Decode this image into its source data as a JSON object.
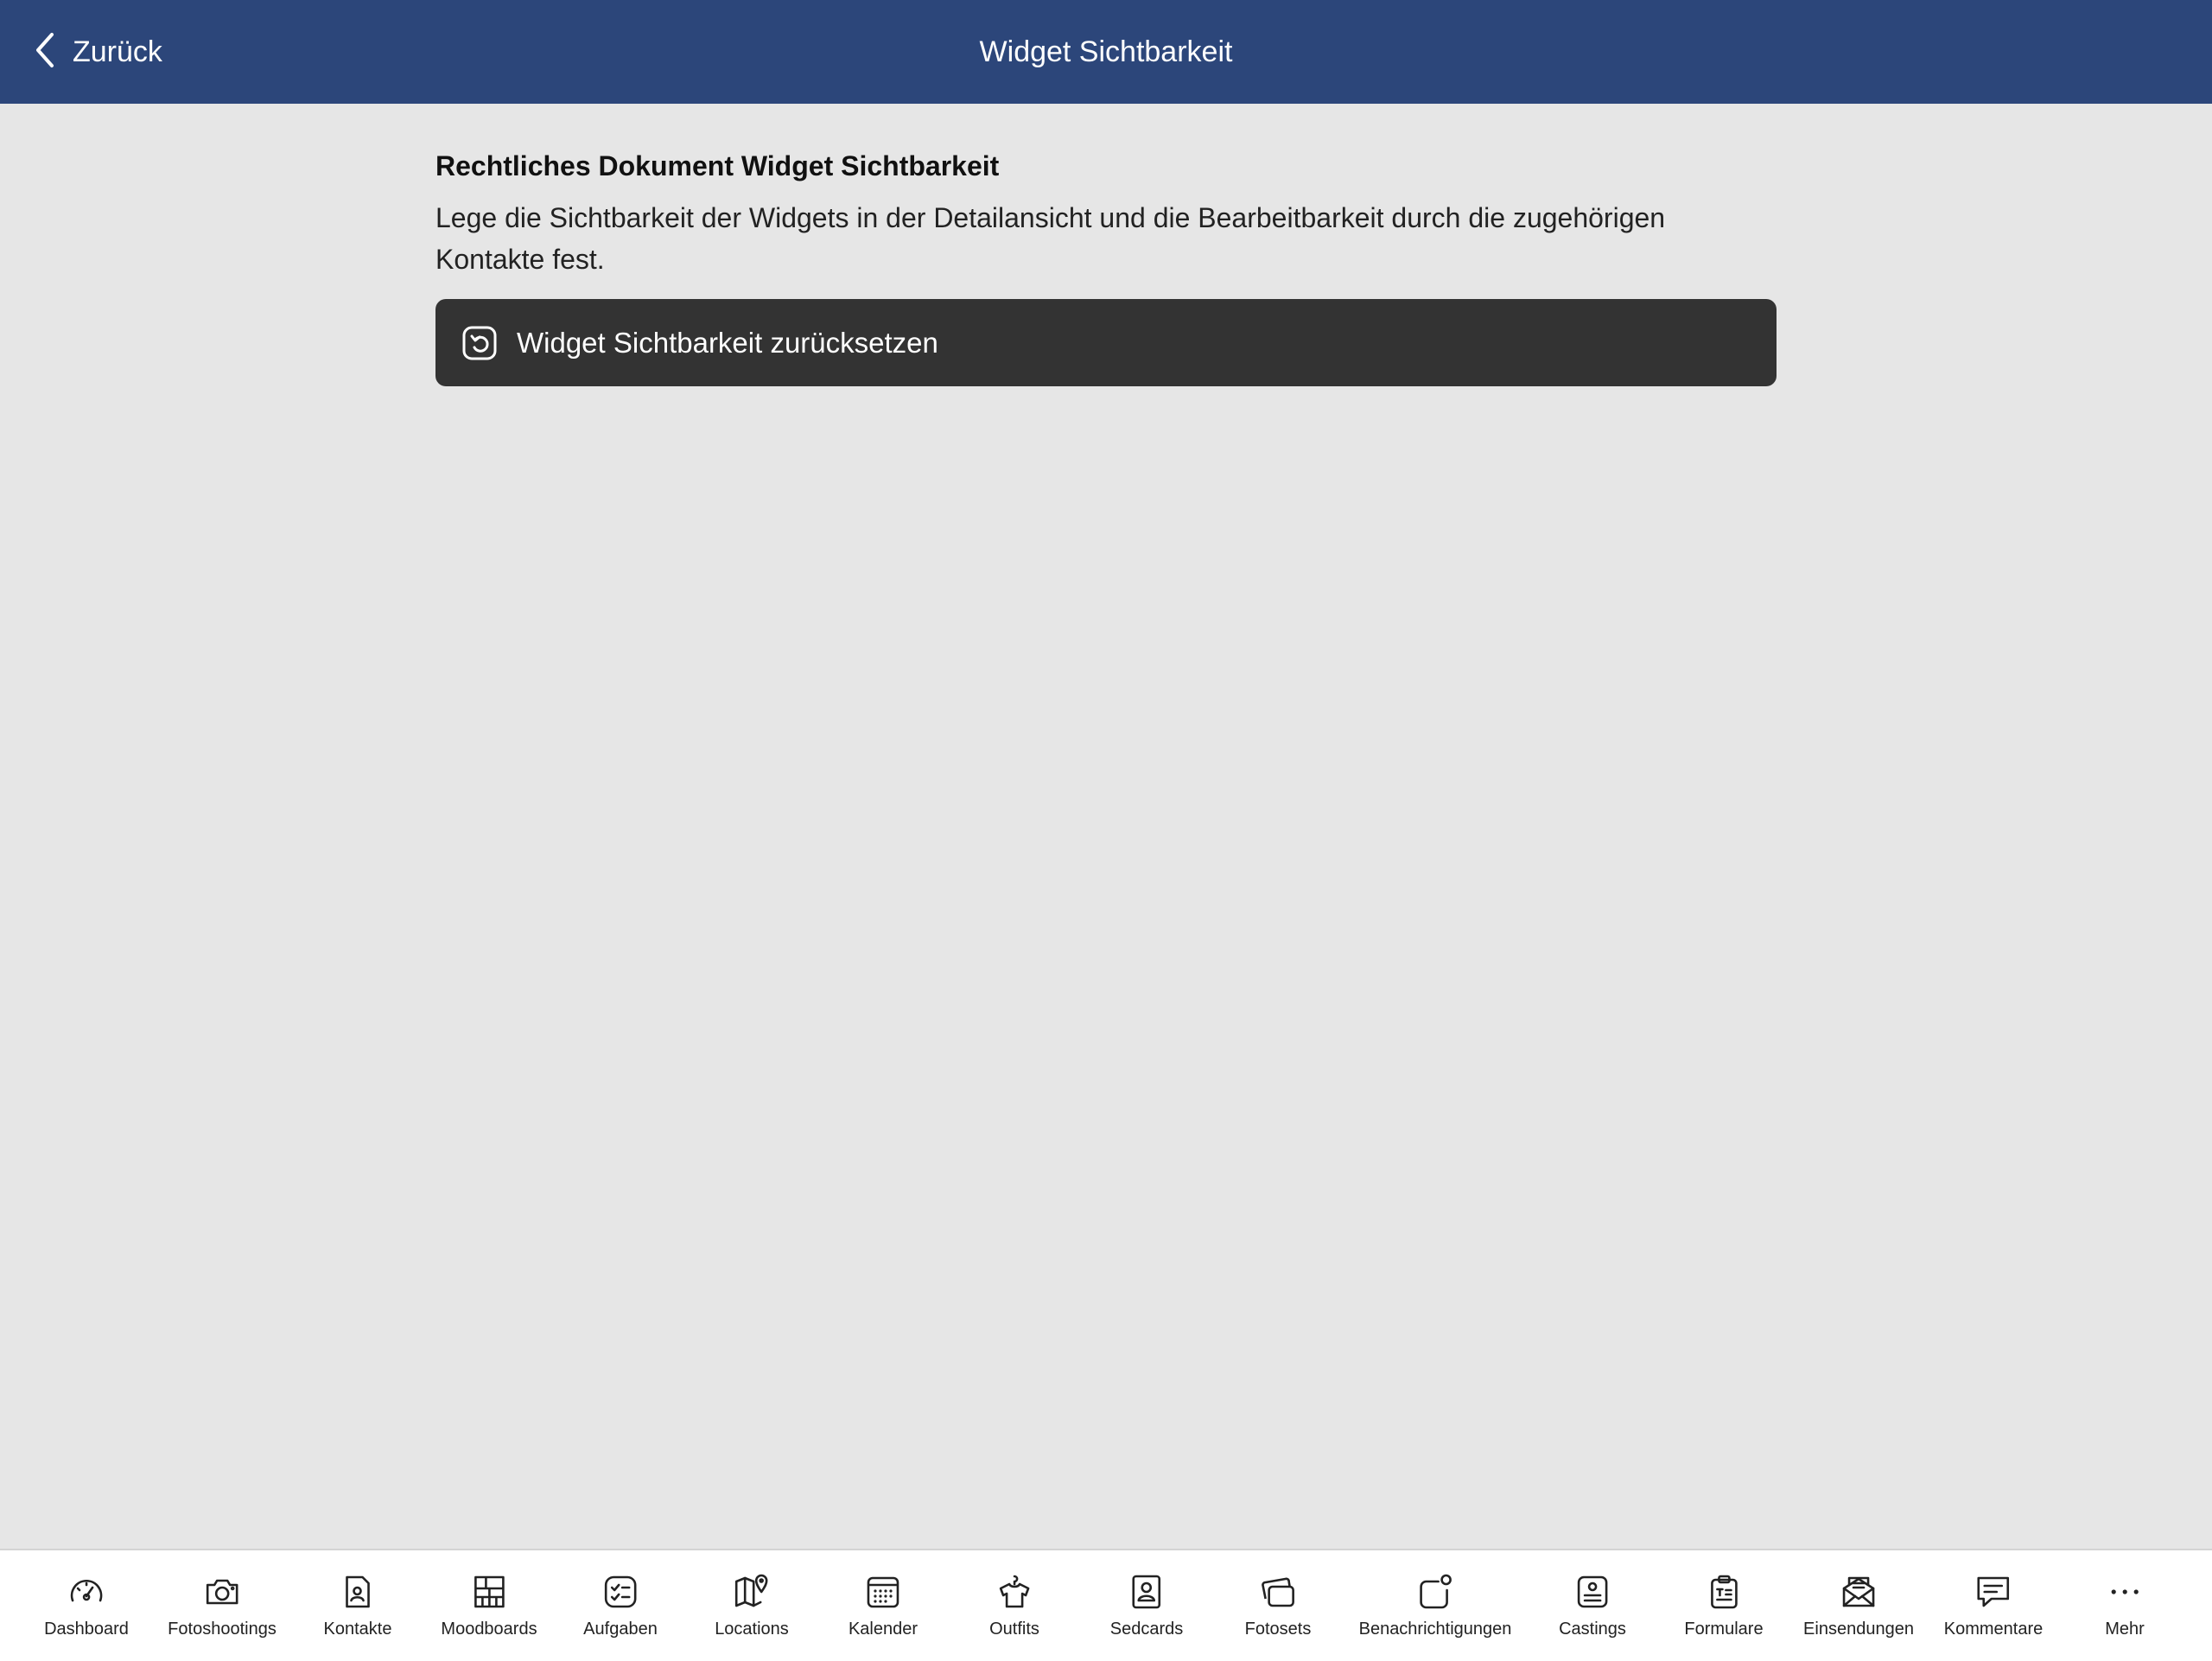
{
  "navbar": {
    "back_label": "Zurück",
    "title": "Widget Sichtbarkeit"
  },
  "content": {
    "section_title": "Rechtliches Dokument Widget Sichtbarkeit",
    "description": "Lege die Sichtbarkeit der Widgets in der Detailansicht und die Bearbeitbarkeit durch die zugehörigen Kontakte fest.",
    "reset_button_label": "Widget Sichtbarkeit zurücksetzen"
  },
  "tabbar": {
    "items": [
      {
        "label": "Dashboard",
        "icon": "speedometer-icon"
      },
      {
        "label": "Fotoshootings",
        "icon": "camera-icon"
      },
      {
        "label": "Kontakte",
        "icon": "contact-card-icon"
      },
      {
        "label": "Moodboards",
        "icon": "grid-board-icon"
      },
      {
        "label": "Aufgaben",
        "icon": "checklist-icon"
      },
      {
        "label": "Locations",
        "icon": "map-pin-icon"
      },
      {
        "label": "Kalender",
        "icon": "calendar-icon"
      },
      {
        "label": "Outfits",
        "icon": "shirt-icon"
      },
      {
        "label": "Sedcards",
        "icon": "portrait-card-icon"
      },
      {
        "label": "Fotosets",
        "icon": "photo-stack-icon"
      },
      {
        "label": "Benachrichtigungen",
        "icon": "notification-icon"
      },
      {
        "label": "Castings",
        "icon": "id-badge-icon"
      },
      {
        "label": "Formulare",
        "icon": "clipboard-icon"
      },
      {
        "label": "Einsendungen",
        "icon": "envelope-open-icon"
      },
      {
        "label": "Kommentare",
        "icon": "comment-icon"
      },
      {
        "label": "Mehr",
        "icon": "more-dots-icon"
      }
    ]
  },
  "colors": {
    "navbar_bg": "#2c467a",
    "page_bg": "#e6e6e6",
    "button_bg": "#333333",
    "tabbar_bg": "#ffffff"
  }
}
